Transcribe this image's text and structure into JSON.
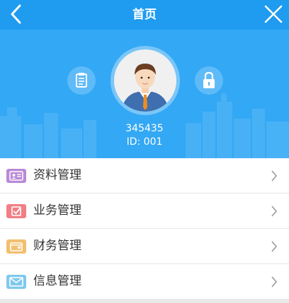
{
  "header": {
    "title": "首页",
    "back_icon": "chevron-left-icon",
    "close_icon": "close-icon"
  },
  "profile": {
    "username": "345435",
    "id_text": "ID: 001",
    "left_action_icon": "clipboard-icon",
    "right_action_icon": "lock-icon",
    "avatar_icon": "businessman-avatar"
  },
  "menu": {
    "items": [
      {
        "label": "资料管理",
        "icon": "profile-card-icon",
        "color": "#b98ad6"
      },
      {
        "label": "业务管理",
        "icon": "checkbox-icon",
        "color": "#f07f86"
      },
      {
        "label": "财务管理",
        "icon": "wallet-icon",
        "color": "#f2bf6e"
      },
      {
        "label": "信息管理",
        "icon": "envelope-icon",
        "color": "#7fc9ee"
      }
    ]
  },
  "colors": {
    "nav": "#1f9bf0",
    "hero": "#33a8f5"
  }
}
